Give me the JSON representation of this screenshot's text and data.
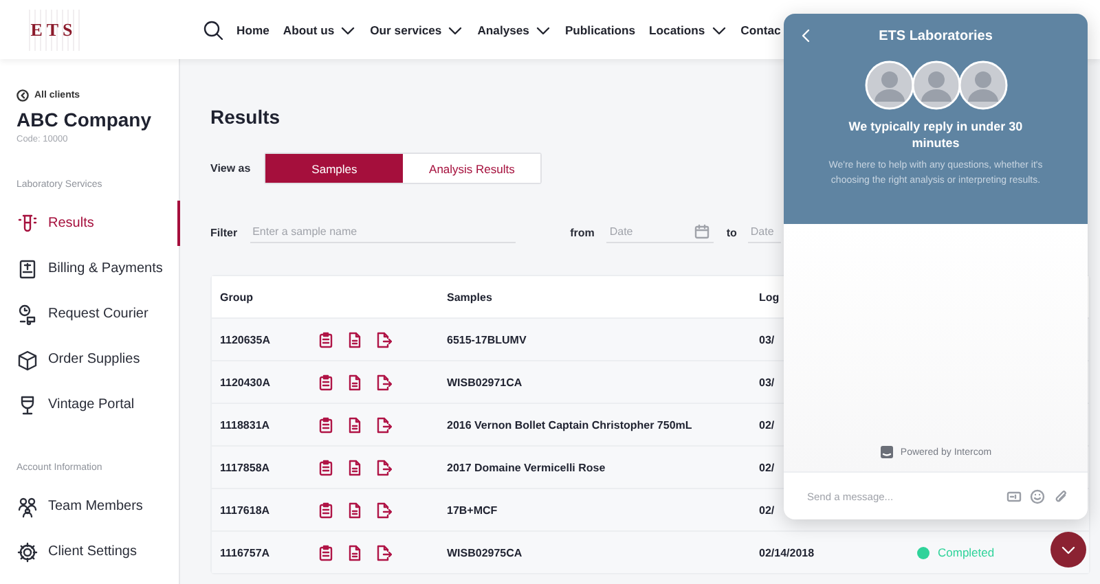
{
  "header": {
    "logo": "ETS",
    "nav": [
      {
        "label": "Home",
        "dropdown": false
      },
      {
        "label": "About us",
        "dropdown": true
      },
      {
        "label": "Our services",
        "dropdown": true
      },
      {
        "label": "Analyses",
        "dropdown": true
      },
      {
        "label": "Publications",
        "dropdown": false
      },
      {
        "label": "Locations",
        "dropdown": true
      },
      {
        "label": "Contac",
        "dropdown": false
      }
    ]
  },
  "sidebar": {
    "back_link": "All clients",
    "company": "ABC Company",
    "code": "Code: 10000",
    "sections": [
      {
        "heading": "Laboratory Services",
        "items": [
          {
            "label": "Results",
            "kind": "tube",
            "selected": true
          },
          {
            "label": "Billing & Payments",
            "kind": "invoice",
            "selected": false
          },
          {
            "label": "Request Courier",
            "kind": "courier",
            "selected": false
          },
          {
            "label": "Order Supplies",
            "kind": "box",
            "selected": false
          },
          {
            "label": "Vintage Portal",
            "kind": "glass",
            "selected": false
          }
        ]
      },
      {
        "heading": "Account Information",
        "items": [
          {
            "label": "Team Members",
            "kind": "team",
            "selected": false
          },
          {
            "label": "Client Settings",
            "kind": "gear",
            "selected": false
          }
        ]
      }
    ]
  },
  "main": {
    "title": "Results",
    "view_as": {
      "label": "View as",
      "options": [
        {
          "label": "Samples",
          "selected": true
        },
        {
          "label": "Analysis Results",
          "selected": false
        }
      ]
    },
    "filter": {
      "label": "Filter",
      "placeholder": "Enter a sample name",
      "from_label": "from",
      "from_placeholder": "Date",
      "to_label": "to",
      "to_placeholder": "Date"
    },
    "table": {
      "columns": [
        "Group",
        "Samples",
        "Log"
      ],
      "rows": [
        {
          "group": "1120635A",
          "sample": "6515-17BLUMV",
          "logged": "03/"
        },
        {
          "group": "1120430A",
          "sample": "WISB02971CA",
          "logged": "03/"
        },
        {
          "group": "1118831A",
          "sample": "2016 Vernon Bollet Captain Christopher 750mL",
          "logged": "02/"
        },
        {
          "group": "1117858A",
          "sample": "2017 Domaine Vermicelli Rose",
          "logged": "02/"
        },
        {
          "group": "1117618A",
          "sample": "17B+MCF",
          "logged": "02/"
        },
        {
          "group": "1116757A",
          "sample": "WISB02975CA",
          "logged": "02/14/2018",
          "status": "Completed",
          "color": "#2fd39a"
        }
      ]
    }
  },
  "chat": {
    "title": "ETS Laboratories",
    "reply_time": "We typically reply in under 30 minutes",
    "intro": "We're here to help with any questions, whether it's choosing the right analysis or interpreting results.",
    "powered_by": "Powered by Intercom",
    "placeholder": "Send a message..."
  }
}
